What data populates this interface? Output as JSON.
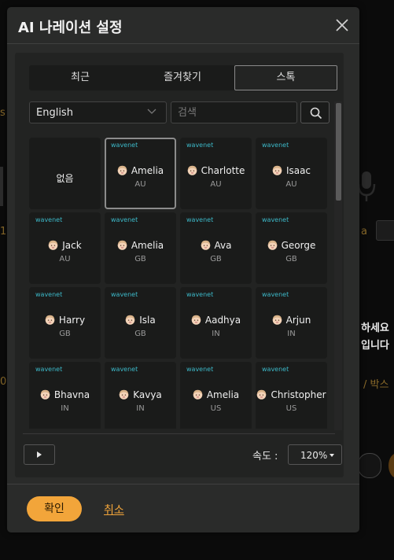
{
  "background": {
    "fragments": [
      {
        "text": "s"
      },
      {
        "text": "1"
      },
      {
        "text": "a"
      },
      {
        "text": "0"
      },
      {
        "text": "/ 박스"
      }
    ],
    "korean_line1": "하세요",
    "korean_line2": "입니다"
  },
  "modal": {
    "title": "AI 나레이션 설정",
    "tabs": [
      {
        "label": "최근"
      },
      {
        "label": "즐겨찾기"
      },
      {
        "label": "스톡"
      }
    ],
    "active_tab": "스톡",
    "language": {
      "selected": "English"
    },
    "search": {
      "placeholder": "검색",
      "value": ""
    },
    "voices": [
      {
        "engine": "",
        "name": "없음",
        "region": ""
      },
      {
        "engine": "wavenet",
        "name": "Amelia",
        "region": "AU"
      },
      {
        "engine": "wavenet",
        "name": "Charlotte",
        "region": "AU"
      },
      {
        "engine": "wavenet",
        "name": "Isaac",
        "region": "AU"
      },
      {
        "engine": "wavenet",
        "name": "Jack",
        "region": "AU"
      },
      {
        "engine": "wavenet",
        "name": "Amelia",
        "region": "GB"
      },
      {
        "engine": "wavenet",
        "name": "Ava",
        "region": "GB"
      },
      {
        "engine": "wavenet",
        "name": "George",
        "region": "GB"
      },
      {
        "engine": "wavenet",
        "name": "Harry",
        "region": "GB"
      },
      {
        "engine": "wavenet",
        "name": "Isla",
        "region": "GB"
      },
      {
        "engine": "wavenet",
        "name": "Aadhya",
        "region": "IN"
      },
      {
        "engine": "wavenet",
        "name": "Arjun",
        "region": "IN"
      },
      {
        "engine": "wavenet",
        "name": "Bhavna",
        "region": "IN"
      },
      {
        "engine": "wavenet",
        "name": "Kavya",
        "region": "IN"
      },
      {
        "engine": "wavenet",
        "name": "Amelia",
        "region": "US"
      },
      {
        "engine": "wavenet",
        "name": "Christopher",
        "region": "US"
      }
    ],
    "selected_voice_index": 1,
    "speed": {
      "label": "속도 :",
      "value": "120%"
    },
    "footer": {
      "confirm_label": "확인",
      "cancel_label": "취소"
    },
    "colors": {
      "accent": "#f2a53a",
      "engine_text": "#3cb8c8"
    },
    "icons": {
      "close": "close-icon",
      "search": "search-icon",
      "play": "play-icon",
      "chevron": "chevron-down-icon",
      "avatar": "face-icon"
    }
  }
}
